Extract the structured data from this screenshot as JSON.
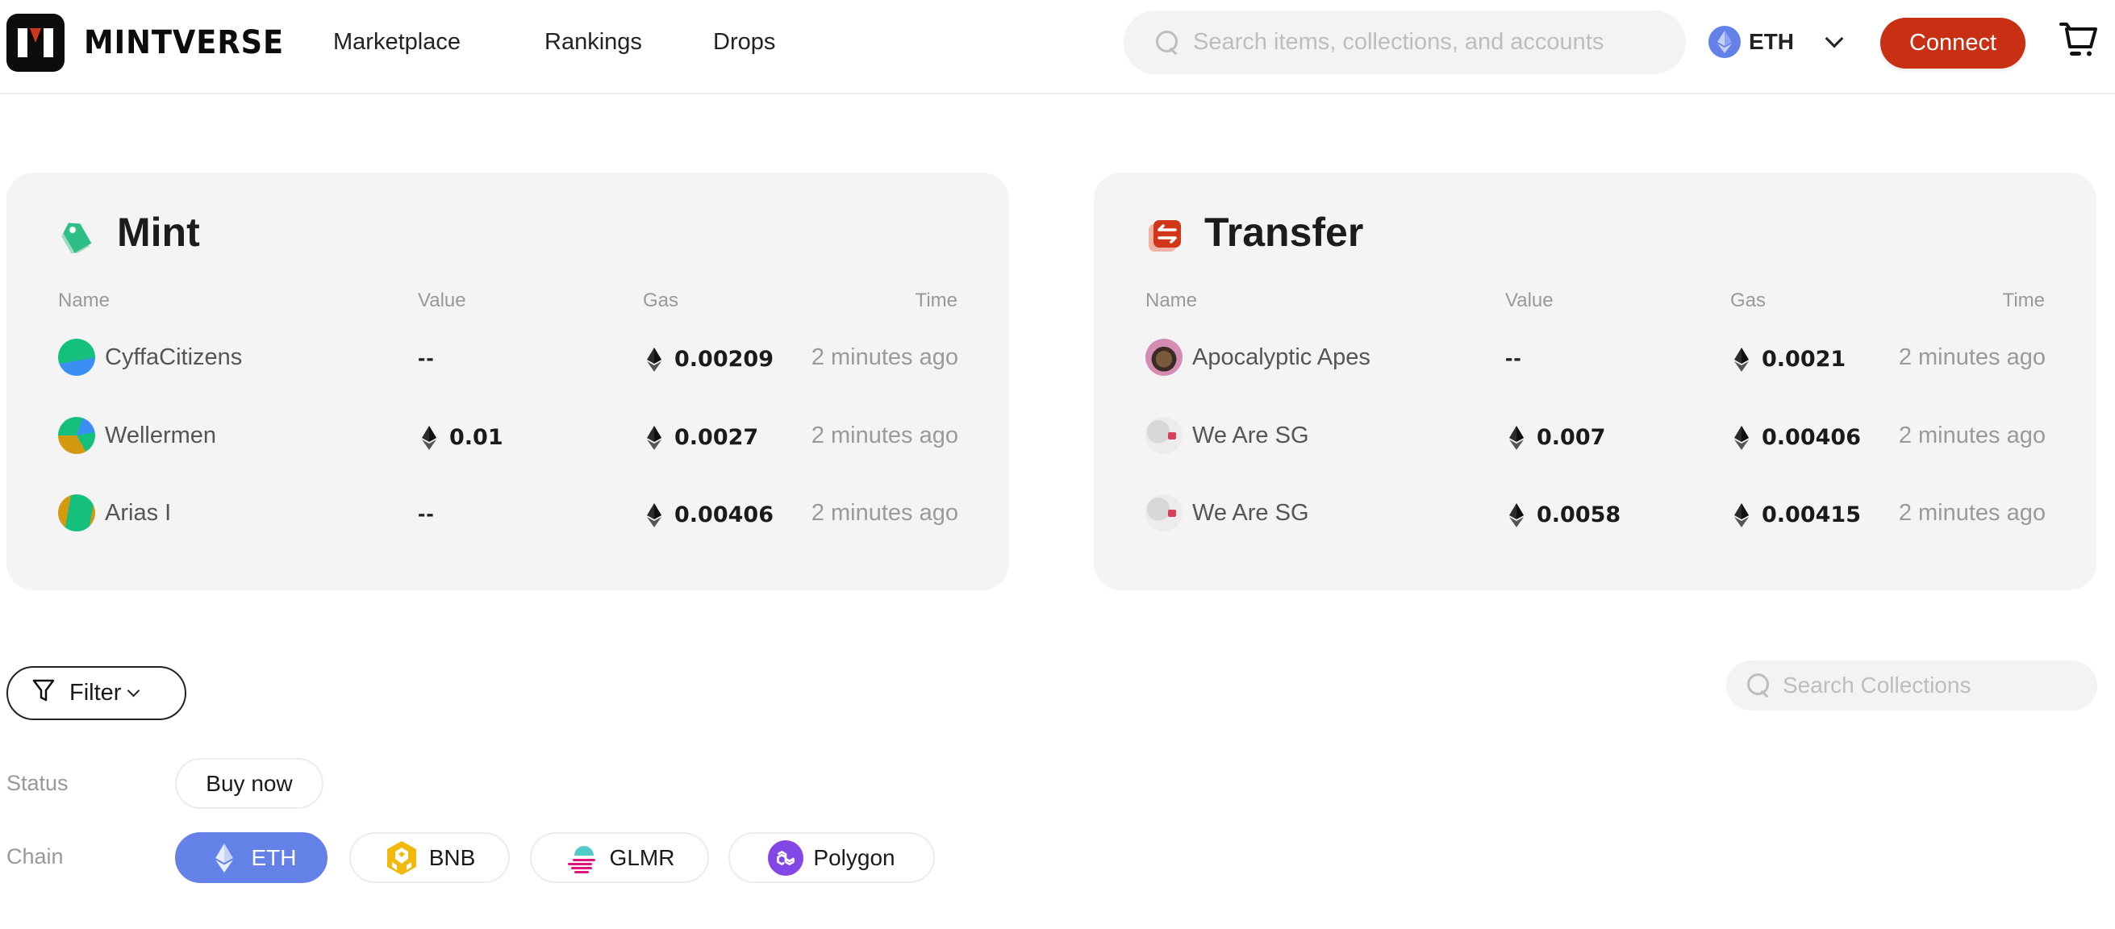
{
  "brand": {
    "name": "MINTVERSE",
    "logo_icon": "mintverse-logo-icon",
    "accent_color": "#d1361a"
  },
  "nav": {
    "items": [
      {
        "label": "Marketplace"
      },
      {
        "label": "Rankings"
      },
      {
        "label": "Drops"
      }
    ]
  },
  "header": {
    "search_placeholder": "Search items, collections, and accounts",
    "chain_selected": "ETH",
    "connect_label": "Connect",
    "connect_color": "#c92f12",
    "cart_icon": "cart-icon"
  },
  "activity": {
    "columns": {
      "name": "Name",
      "value": "Value",
      "gas": "Gas",
      "time": "Time"
    },
    "mint": {
      "title": "Mint",
      "icon": "tag-icon",
      "rows": [
        {
          "name": "CyffaCitizens",
          "value": "--",
          "gas": "0.00209",
          "time": "2 minutes ago"
        },
        {
          "name": "Wellermen",
          "value": "0.01",
          "gas": "0.0027",
          "time": "2 minutes ago"
        },
        {
          "name": "Arias I",
          "value": "--",
          "gas": "0.00406",
          "time": "2 minutes ago"
        }
      ]
    },
    "transfer": {
      "title": "Transfer",
      "icon": "transfer-arrows-icon",
      "rows": [
        {
          "name": "Apocalyptic Apes",
          "value": "--",
          "gas": "0.0021",
          "time": "2 minutes ago"
        },
        {
          "name": "We Are SG",
          "value": "0.007",
          "gas": "0.00406",
          "time": "2 minutes ago"
        },
        {
          "name": "We Are SG",
          "value": "0.0058",
          "gas": "0.00415",
          "time": "2 minutes ago"
        }
      ]
    }
  },
  "filters": {
    "filter_label": "Filter",
    "collection_search_placeholder": "Search Collections",
    "status": {
      "label": "Status",
      "options": [
        {
          "label": "Buy now"
        }
      ]
    },
    "chain": {
      "label": "Chain",
      "options": [
        {
          "label": "ETH",
          "icon": "ethereum-icon",
          "active": true
        },
        {
          "label": "BNB",
          "icon": "bnb-icon",
          "active": false
        },
        {
          "label": "GLMR",
          "icon": "glmr-icon",
          "active": false
        },
        {
          "label": "Polygon",
          "icon": "polygon-icon",
          "active": false
        }
      ]
    }
  }
}
